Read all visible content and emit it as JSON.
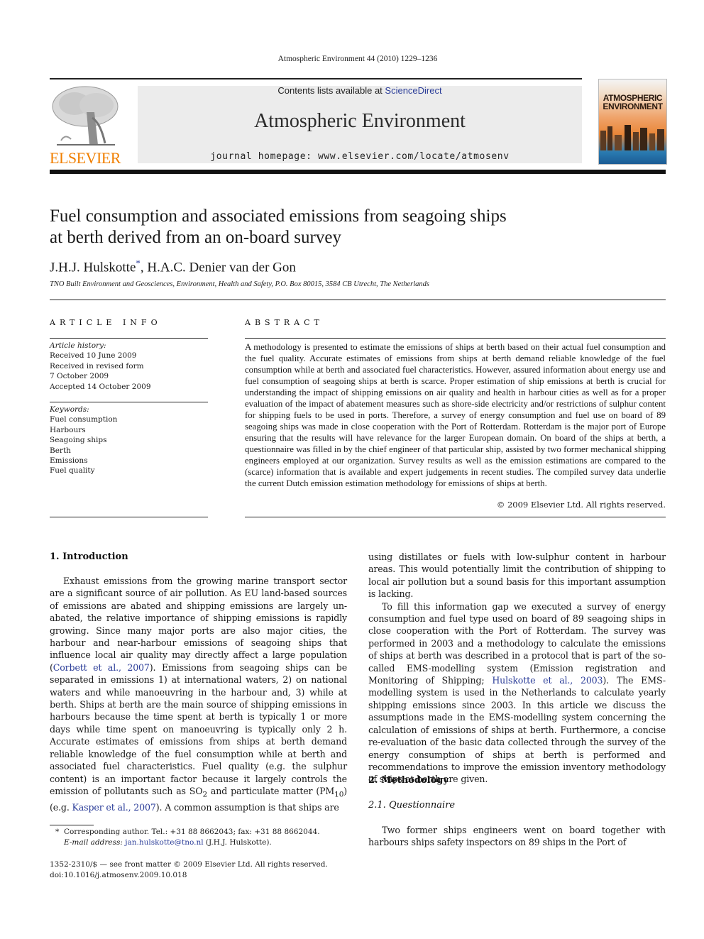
{
  "header": {
    "citation": "Atmospheric Environment 44 (2010) 1229–1236",
    "contents_prefix": "Contents lists available at ",
    "contents_link": "ScienceDirect",
    "journal_name": "Atmospheric Environment",
    "homepage": "journal homepage: www.elsevier.com/locate/atmosenv",
    "publisher_logo_text": "ELSEVIER",
    "cover_title_line1": "ATMOSPHERIC",
    "cover_title_line2": "ENVIRONMENT"
  },
  "article": {
    "title_line1": "Fuel consumption and associated emissions from seagoing ships",
    "title_line2": "at berth derived from an on-board survey",
    "author1": "J.H.J. Hulskotte",
    "author1_mark": "*",
    "author2": ", H.A.C. Denier van der Gon",
    "affiliation": "TNO Built Environment and Geosciences, Environment, Health and Safety, P.O. Box 80015, 3584 CB Utrecht, The Netherlands"
  },
  "article_info": {
    "heading": "ARTICLE INFO",
    "history_label": "Article history:",
    "history": [
      "Received 10 June 2009",
      "Received in revised form",
      "7 October 2009",
      "Accepted 14 October 2009"
    ],
    "keywords_label": "Keywords:",
    "keywords": [
      "Fuel consumption",
      "Harbours",
      "Seagoing ships",
      "Berth",
      "Emissions",
      "Fuel quality"
    ]
  },
  "abstract": {
    "heading": "ABSTRACT",
    "text": "A methodology is presented to estimate the emissions of ships at berth based on their actual fuel consumption and the fuel quality. Accurate estimates of emissions from ships at berth demand reliable knowledge of the fuel consumption while at berth and associated fuel characteristics. However, assured information about energy use and fuel consumption of seagoing ships at berth is scarce. Proper estimation of ship emissions at berth is crucial for understanding the impact of shipping emissions on air quality and health in harbour cities as well as for a proper evaluation of the impact of abatement measures such as shore-side electricity and/or restrictions of sulphur content for shipping fuels to be used in ports. Therefore, a survey of energy consumption and fuel use on board of 89 seagoing ships was made in close cooperation with the Port of Rotterdam. Rotterdam is the major port of Europe ensuring that the results will have relevance for the larger European domain. On board of the ships at berth, a questionnaire was filled in by the chief engineer of that particular ship, assisted by two former mechanical shipping engineers employed at our organization. Survey results as well as the emission estimations are compared to the (scarce) information that is available and expert judgements in recent studies. The compiled survey data underlie the current Dutch emission estimation methodology for emissions of ships at berth.",
    "copyright": "© 2009 Elsevier Ltd. All rights reserved."
  },
  "body": {
    "section1_heading": "1.  Introduction",
    "intro_p1_a": "Exhaust emissions from the growing marine transport sector are a significant source of air pollution. As EU land-based sources of emissions are abated and shipping emissions are largely un-abated, the relative importance of shipping emissions is rapidly growing. Since many major ports are also major cities, the harbour and near-harbour emissions of seagoing ships that influence local air quality may directly affect a large population (",
    "intro_ref1": "Corbett et al., 2007",
    "intro_p1_b": "). Emissions from seagoing ships can be separated in emissions 1) at international waters, 2) on national waters and while manoeuvring in the harbour and, 3) while at berth. Ships at berth are the main source of shipping emissions in harbours because the time spent at berth is typically 1 or more days while time spent on manoeuvring is typically only 2 h. Accurate estimates of emissions from ships at berth demand reliable knowledge of the fuel consumption while at berth and associated fuel characteristics. Fuel quality (e.g. the sulphur content) is an important factor because it largely controls the emission of pollutants such as SO",
    "intro_so2_sub": "2",
    "intro_p1_c": " and particulate matter (PM",
    "intro_pm_sub": "10",
    "intro_p1_d": ") (e.g. ",
    "intro_ref2": "Kasper et al., 2007",
    "intro_p1_e": "). A common assumption is that ships are",
    "right_p1": "using distillates or fuels with low-sulphur content in harbour areas. This would potentially limit the contribution of shipping to local air pollution but a sound basis for this important assumption is lacking.",
    "right_p2_a": "To fill this information gap we executed a survey of energy consumption and fuel type used on board of 89 seagoing ships in close cooperation with the Port of Rotterdam. The survey was performed in 2003 and a methodology to calculate the emissions of ships at berth was described in a protocol that is part of the so-called EMS-modelling system (Emission registration and Monitoring of Shipping; ",
    "right_ref": "Hulskotte et al., 2003",
    "right_p2_b": "). The EMS-modelling system is used in the Netherlands to calculate yearly shipping emissions since 2003. In this article we discuss the assumptions made in the EMS-modelling system concerning the calculation of emissions of ships at berth. Furthermore, a concise re-evaluation of the basic data collected through the survey of the energy consumption of ships at berth is performed and recommendations to improve the emission inventory methodology of ships at berth are given.",
    "section2_heading": "2.  Methodology",
    "section21_heading": "2.1.  Questionnaire",
    "method_p1": "Two former ships engineers went on board together with harbours ships safety inspectors on 89 ships in the Port of"
  },
  "footnotes": {
    "mark": "*",
    "corresponding": "Corresponding author. Tel.: +31 88 8662043; fax: +31 88 8662044.",
    "email_label": "E-mail address: ",
    "email": "jan.hulskotte@tno.nl",
    "email_suffix": " (J.H.J. Hulskotte).",
    "front_matter": "1352-2310/$ — see front matter © 2009 Elsevier Ltd. All rights reserved.",
    "doi": "doi:10.1016/j.atmosenv.2009.10.018"
  }
}
